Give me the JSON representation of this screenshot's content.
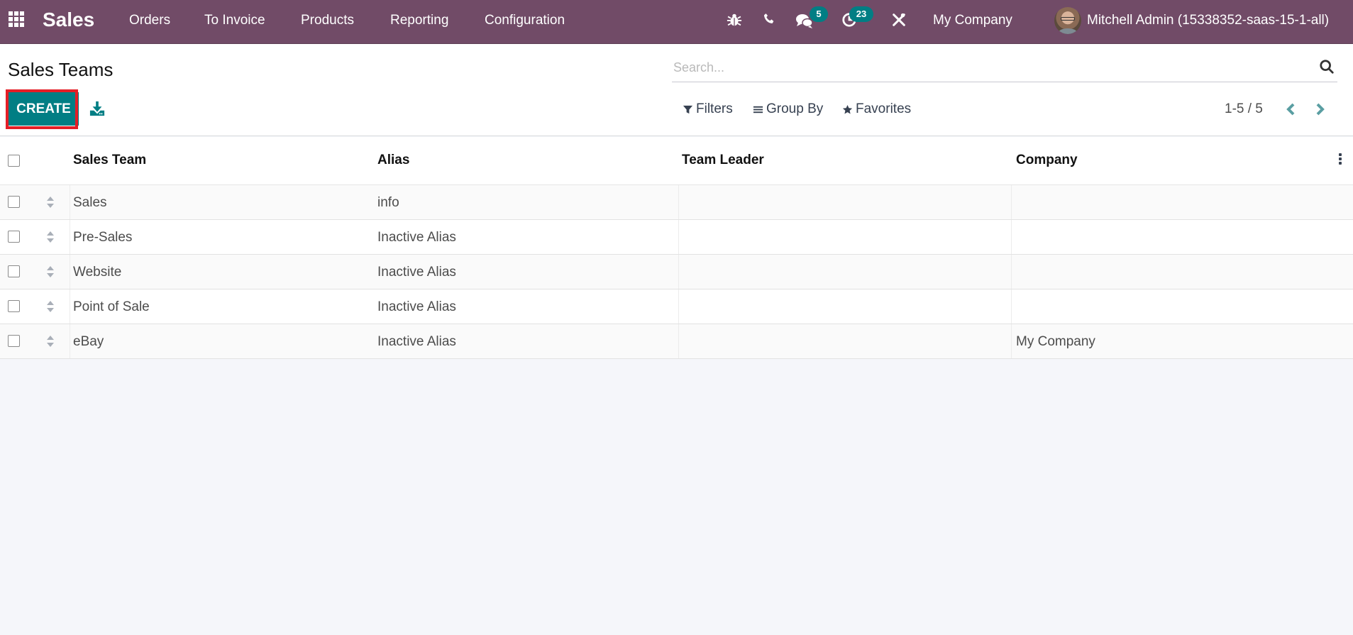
{
  "navbar": {
    "app_name": "Sales",
    "menu": [
      "Orders",
      "To Invoice",
      "Products",
      "Reporting",
      "Configuration"
    ],
    "icons": {
      "apps": "apps-grid-icon",
      "debug": "bug-icon",
      "phone": "phone-icon",
      "messages": "chat-bubbles-icon",
      "activities": "clock-icon",
      "tools": "tools-icon"
    },
    "messages_count": "5",
    "activities_count": "23",
    "company": "My Company",
    "user": "Mitchell Admin (15338352-saas-15-1-all)",
    "colors": {
      "bar": "#714b67",
      "badge": "#017e84"
    }
  },
  "control_panel": {
    "title": "Sales Teams",
    "create_label": "CREATE",
    "download_icon": "download-icon",
    "search": {
      "placeholder": "Search...",
      "value": ""
    },
    "filters_label": "Filters",
    "group_by_label": "Group By",
    "favorites_label": "Favorites",
    "pager": "1-5 / 5",
    "highlight_color": "#e41e26",
    "accent": "#017e84"
  },
  "table": {
    "columns": [
      "Sales Team",
      "Alias",
      "Team Leader",
      "Company"
    ],
    "rows": [
      {
        "team": "Sales",
        "alias": "info",
        "leader": "",
        "company": ""
      },
      {
        "team": "Pre-Sales",
        "alias": "Inactive Alias",
        "leader": "",
        "company": ""
      },
      {
        "team": "Website",
        "alias": "Inactive Alias",
        "leader": "",
        "company": ""
      },
      {
        "team": "Point of Sale",
        "alias": "Inactive Alias",
        "leader": "",
        "company": ""
      },
      {
        "team": "eBay",
        "alias": "Inactive Alias",
        "leader": "",
        "company": "My Company"
      }
    ]
  }
}
